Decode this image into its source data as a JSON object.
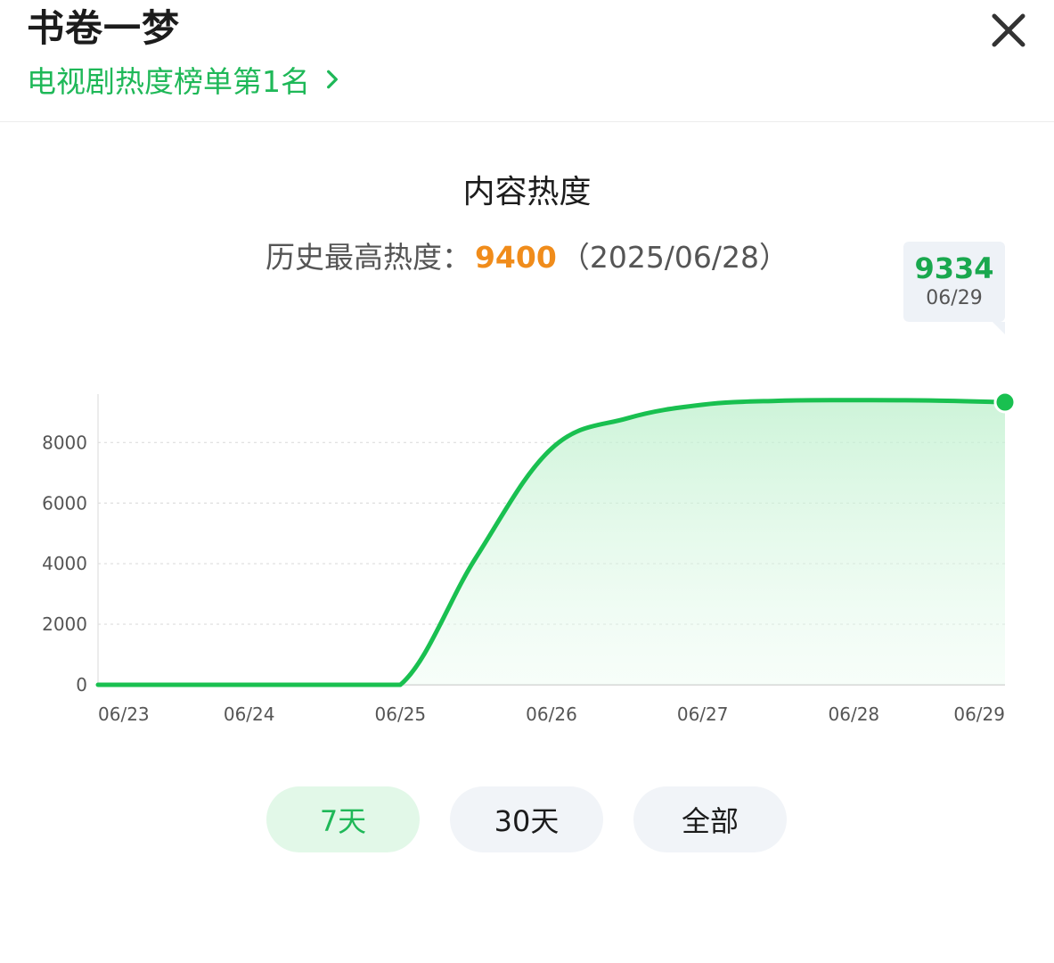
{
  "header": {
    "title": "书卷一梦",
    "rank_link": "电视剧热度榜单第1名",
    "close_icon": "close-icon",
    "chevron_icon": "chevron-right-icon"
  },
  "section": {
    "title": "内容热度",
    "history_label": "历史最高热度：",
    "history_value": "9400",
    "history_date": "（2025/06/28）"
  },
  "tooltip": {
    "value": "9334",
    "date": "06/29"
  },
  "range_tabs": [
    {
      "label": "7天",
      "active": true
    },
    {
      "label": "30天",
      "active": false
    },
    {
      "label": "全部",
      "active": false
    }
  ],
  "colors": {
    "accent": "#1fb858",
    "highlight": "#f08c1b"
  },
  "chart_data": {
    "type": "area",
    "x": [
      "06/23",
      "06/23.5",
      "06/24",
      "06/24.5",
      "06/25",
      "06/25.5",
      "06/26",
      "06/26.5",
      "06/27",
      "06/27.5",
      "06/28",
      "06/28.5",
      "06/29"
    ],
    "categories": [
      "06/23",
      "06/24",
      "06/25",
      "06/26",
      "06/27",
      "06/28",
      "06/29"
    ],
    "values": [
      0,
      0,
      0,
      0,
      0,
      4200,
      7800,
      8800,
      9250,
      9380,
      9400,
      9390,
      9334
    ],
    "yticks": [
      0,
      2000,
      4000,
      6000,
      8000
    ],
    "ylim": [
      0,
      9600
    ],
    "grid": true,
    "title": "",
    "xlabel": "",
    "ylabel": ""
  }
}
